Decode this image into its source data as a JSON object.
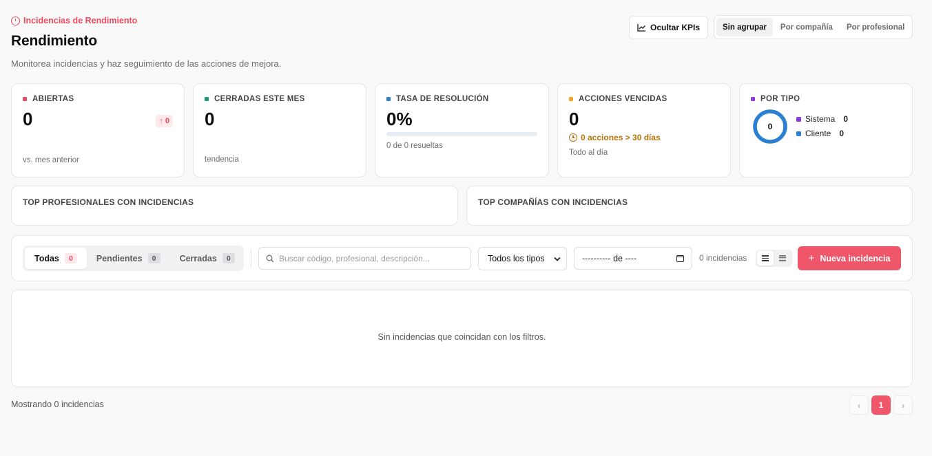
{
  "header": {
    "eyebrow": "Incidencias de Rendimiento",
    "title": "Rendimiento",
    "subtitle": "Monitorea incidencias y haz seguimiento de las acciones de mejora.",
    "hide_kpis_label": "Ocultar KPIs",
    "grouping": [
      "Sin agrupar",
      "Por compañía",
      "Por profesional"
    ]
  },
  "kpis": {
    "abiertas": {
      "label": "ABIERTAS",
      "value": "0",
      "delta": "0",
      "foot": "vs. mes anterior",
      "color": "#ef4a5e"
    },
    "cerradas": {
      "label": "CERRADAS ESTE MES",
      "value": "0",
      "foot": "tendencia",
      "color": "#16a06a"
    },
    "tasa": {
      "label": "TASA DE RESOLUCIÓN",
      "value": "0%",
      "progress": 0,
      "foot": "0 de 0 resueltas",
      "color": "#2b7fd1"
    },
    "vencidas": {
      "label": "ACCIONES VENCIDAS",
      "value": "0",
      "warning": "0 acciones > 30 días",
      "foot": "Todo al día",
      "color": "#f0a020"
    },
    "por_tipo": {
      "label": "POR TIPO",
      "total": "0",
      "color": "#8b3fd9",
      "items": [
        {
          "label": "Sistema",
          "value": "0",
          "color": "#8b3fd9"
        },
        {
          "label": "Cliente",
          "value": "0",
          "color": "#2b7fd1"
        }
      ]
    }
  },
  "top_profesionales": {
    "title": "TOP PROFESIONALES CON INCIDENCIAS"
  },
  "top_companias": {
    "title": "TOP COMPAÑÍAS CON INCIDENCIAS"
  },
  "filters": {
    "tabs": [
      {
        "label": "Todas",
        "count": "0"
      },
      {
        "label": "Pendientes",
        "count": "0"
      },
      {
        "label": "Cerradas",
        "count": "0"
      }
    ],
    "search_placeholder": "Buscar código, profesional, descripción...",
    "type_select": "Todos los tipos",
    "date_value": "---------- de ----",
    "result_count": "0 incidencias",
    "new_button": "Nueva incidencia"
  },
  "empty_message": "Sin incidencias que coincidan con los filtros.",
  "footer": {
    "showing": "Mostrando 0 incidencias",
    "current_page": "1"
  }
}
